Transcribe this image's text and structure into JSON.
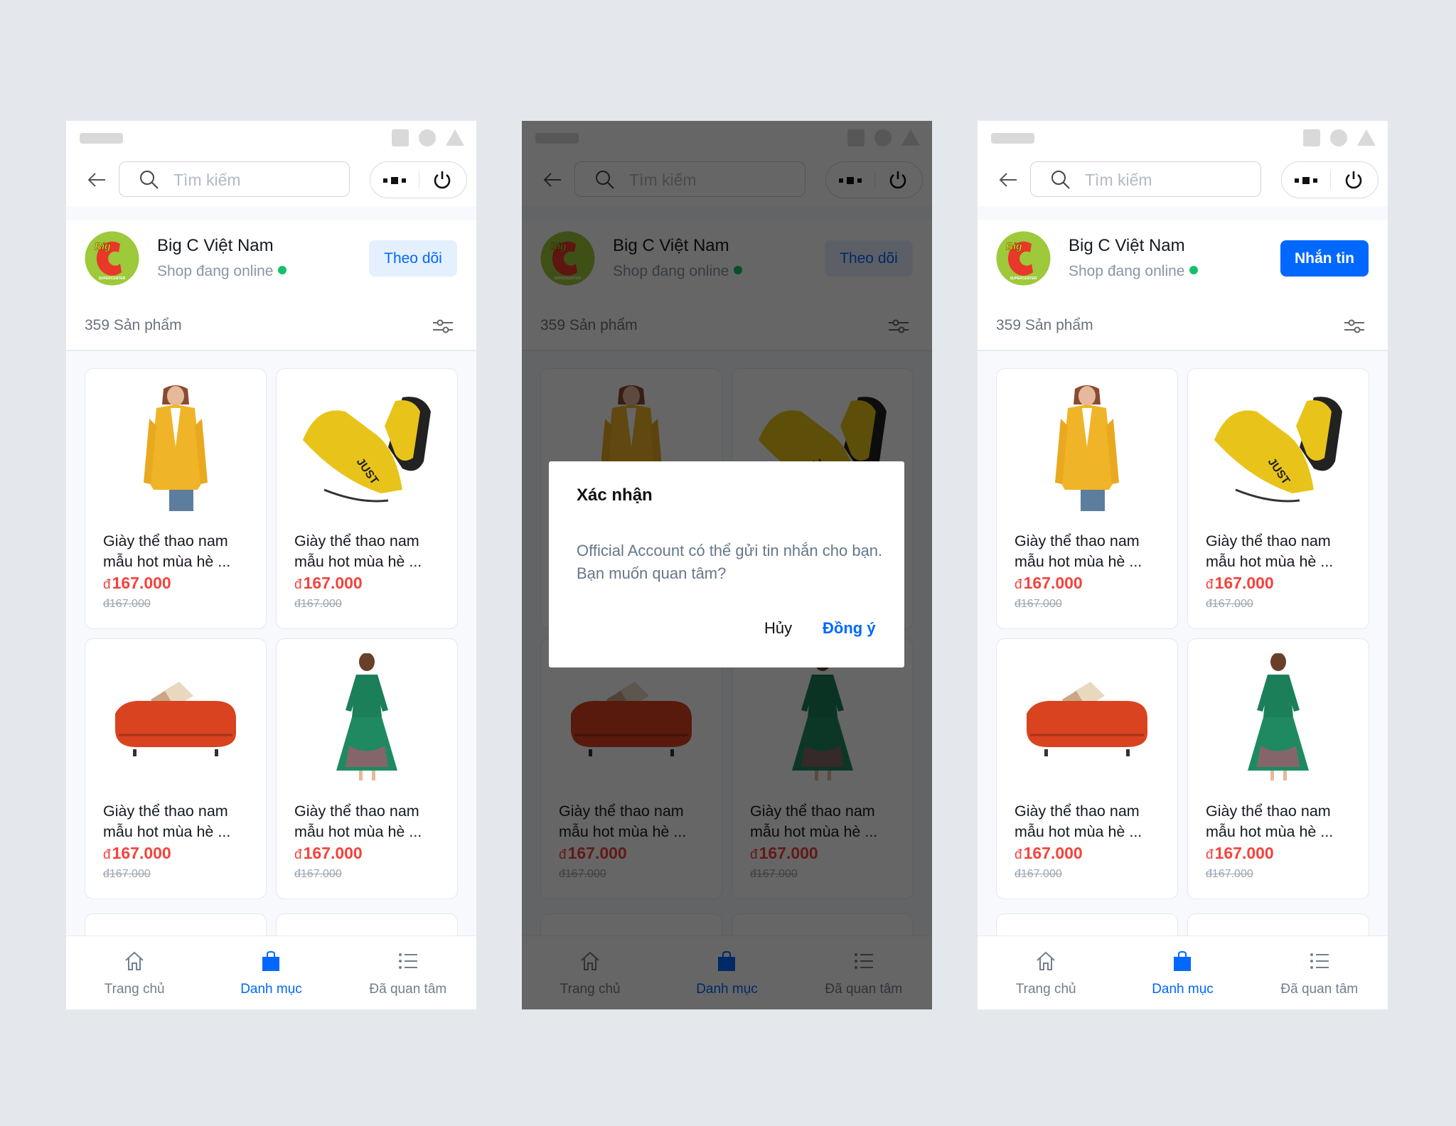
{
  "colors": {
    "accent": "#0068ff",
    "price": "#f4433c",
    "online": "#12c26b",
    "background": "#e4e8ed"
  },
  "products": [
    {
      "title": "Giày thể thao nam mẫu hot mùa hè ...",
      "currency": "đ",
      "price": "167.000",
      "old_price": "đ167.000",
      "image": "yellow-blazer"
    },
    {
      "title": "Giày thể thao nam mẫu hot mùa hè ...",
      "currency": "đ",
      "price": "167.000",
      "old_price": "đ167.000",
      "image": "yellow-sneakers"
    },
    {
      "title": "Giày thể thao nam mẫu hot mùa hè ...",
      "currency": "đ",
      "price": "167.000",
      "old_price": "đ167.000",
      "image": "red-sofa"
    },
    {
      "title": "Giày thể thao nam mẫu hot mùa hè ...",
      "currency": "đ",
      "price": "167.000",
      "old_price": "đ167.000",
      "image": "green-dress"
    }
  ],
  "screens": [
    {
      "search_placeholder": "Tìm kiếm",
      "shop": {
        "name": "Big C Việt Nam",
        "status": "Shop đang online",
        "action_label": "Theo dõi",
        "action_style": "light"
      },
      "product_count": "359 Sản phẩm",
      "nav": [
        {
          "label": "Trang chủ",
          "icon": "home-icon"
        },
        {
          "label": "Danh mục",
          "icon": "bag-icon",
          "active": true
        },
        {
          "label": "Đã quan tâm",
          "icon": "list-icon"
        }
      ]
    },
    {
      "search_placeholder": "Tìm kiếm",
      "shop": {
        "name": "Big C Việt Nam",
        "status": "Shop đang online",
        "action_label": "Theo dõi",
        "action_style": "light"
      },
      "product_count": "359 Sản phẩm",
      "nav": [
        {
          "label": "Trang chủ",
          "icon": "home-icon"
        },
        {
          "label": "Danh mục",
          "icon": "bag-icon",
          "active": true
        },
        {
          "label": "Đã quan tâm",
          "icon": "list-icon"
        }
      ],
      "dialog": {
        "title": "Xác nhận",
        "body": "Official Account có thể gửi tin nhắn cho bạn. Bạn muốn quan tâm?",
        "cancel": "Hủy",
        "confirm": "Đồng ý"
      }
    },
    {
      "search_placeholder": "Tìm kiếm",
      "shop": {
        "name": "Big C Việt Nam",
        "status": "Shop đang online",
        "action_label": "Nhắn tin",
        "action_style": "solid"
      },
      "product_count": "359 Sản phẩm",
      "nav": [
        {
          "label": "Trang chủ",
          "icon": "home-icon"
        },
        {
          "label": "Danh mục",
          "icon": "bag-icon",
          "active": true
        },
        {
          "label": "Đã quan tâm",
          "icon": "list-icon"
        }
      ]
    }
  ]
}
